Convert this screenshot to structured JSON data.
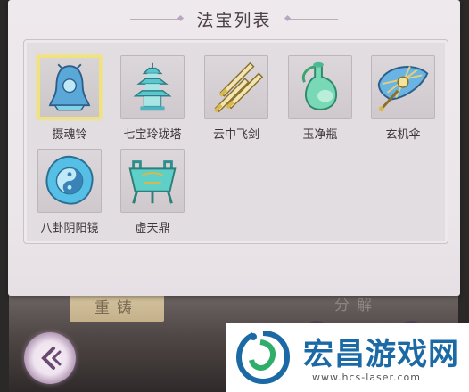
{
  "panel": {
    "title": "法宝列表"
  },
  "items": [
    {
      "label": "摄魂铃",
      "icon": "bell-artifact-icon",
      "selected": true
    },
    {
      "label": "七宝玲珑塔",
      "icon": "pagoda-artifact-icon",
      "selected": false
    },
    {
      "label": "云中飞剑",
      "icon": "flying-swords-icon",
      "selected": false
    },
    {
      "label": "玉净瓶",
      "icon": "jade-vase-icon",
      "selected": false
    },
    {
      "label": "玄机伞",
      "icon": "umbrella-artifact-icon",
      "selected": false
    },
    {
      "label": "八卦阴阳镜",
      "icon": "yin-yang-mirror-icon",
      "selected": false
    },
    {
      "label": "虚天鼎",
      "icon": "cauldron-artifact-icon",
      "selected": false
    }
  ],
  "buttons": {
    "recast": "重铸",
    "decompose": "分解"
  },
  "watermark": {
    "title": "宏昌游戏网",
    "url": "www.hcs-laser.com"
  },
  "colors": {
    "panel_bg": "#eee9ec",
    "selected_border": "#f2e27a",
    "artifact_cyan": "#4fc3d6",
    "watermark_blue": "#1b6aa6"
  }
}
